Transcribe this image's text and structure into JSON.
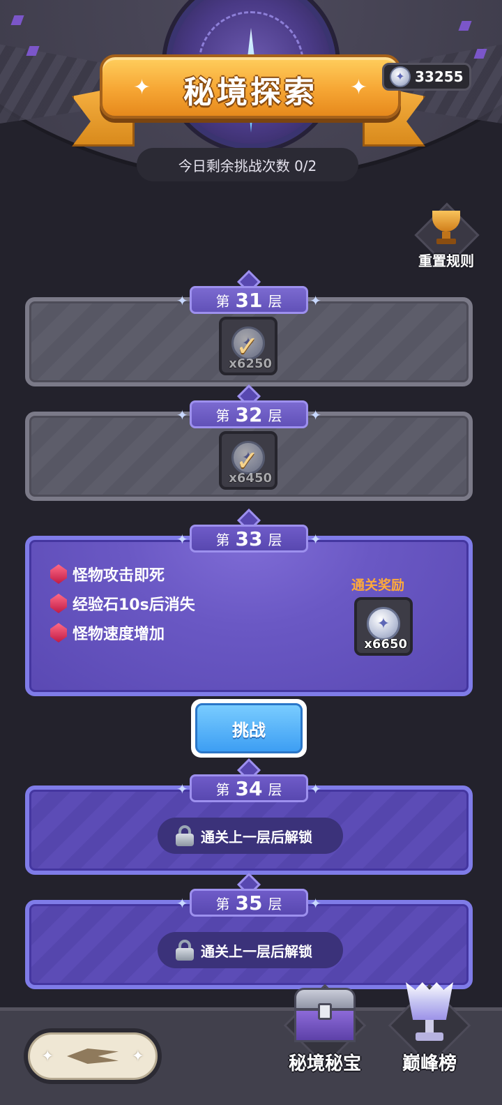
{
  "header": {
    "title": "秘境探索",
    "attempts_text": "今日剩余挑战次数 0/2",
    "currency_amount": "33255",
    "currency_icon": "star-coin-icon"
  },
  "reset_rules_label": "重置规则",
  "floors": [
    {
      "prefix": "第",
      "number": "31",
      "suffix": "层",
      "status": "cleared",
      "reward_qty": "x6250"
    },
    {
      "prefix": "第",
      "number": "32",
      "suffix": "层",
      "status": "cleared",
      "reward_qty": "x6450"
    },
    {
      "prefix": "第",
      "number": "33",
      "suffix": "层",
      "status": "current",
      "modifiers": [
        "怪物攻击即死",
        "经验石10s后消失",
        "怪物速度增加"
      ],
      "reward_title": "通关奖励",
      "reward_qty": "x6650"
    },
    {
      "prefix": "第",
      "number": "34",
      "suffix": "层",
      "status": "locked",
      "lock_text": "通关上一层后解锁"
    },
    {
      "prefix": "第",
      "number": "35",
      "suffix": "层",
      "status": "locked",
      "lock_text": "通关上一层后解锁"
    }
  ],
  "challenge_label": "挑战",
  "bottom": {
    "treasure_label": "秘境秘宝",
    "leaderboard_label": "巅峰榜"
  },
  "colors": {
    "accent_orange": "#f6a634",
    "floor_purple": "#6a58c4",
    "challenge_blue": "#3d9ef3",
    "reward_title_orange": "#ffaa3a"
  }
}
